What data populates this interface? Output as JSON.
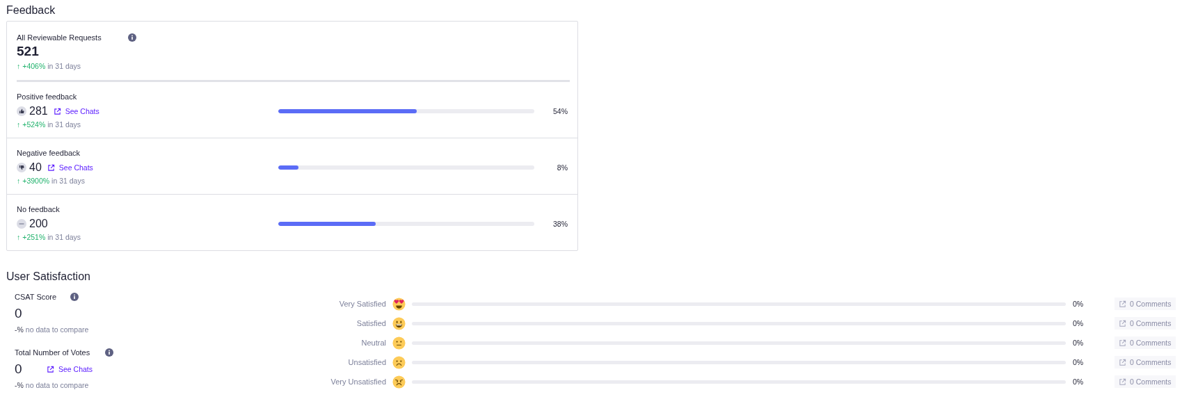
{
  "feedback": {
    "title": "Feedback",
    "total": {
      "label": "All Reviewable Requests",
      "value": "521",
      "trend": {
        "arrow": "↑",
        "change": "+406%",
        "period": "in 31 days"
      }
    },
    "rows": [
      {
        "label": "Positive feedback",
        "kind": "thumbs_up",
        "value": "281",
        "link": "See Chats",
        "level": 0.54,
        "percent": "54%",
        "trend": {
          "arrow": "↑",
          "change": "+524%",
          "period": "in 31 days"
        }
      },
      {
        "label": "Negative feedback",
        "kind": "thumbs_down",
        "value": "40",
        "link": "See Chats",
        "level": 0.08,
        "percent": "8%",
        "trend": {
          "arrow": "↑",
          "change": "+3900%",
          "period": "in 31 days"
        }
      },
      {
        "label": "No feedback",
        "kind": "none",
        "value": "200",
        "level": 0.38,
        "percent": "38%",
        "trend": {
          "arrow": "↑",
          "change": "+251%",
          "period": "in 31 days"
        }
      }
    ]
  },
  "satisfaction": {
    "title": "User Satisfaction",
    "stats": [
      {
        "label": "CSAT Score",
        "value": "0",
        "trend": {
          "change": "-%",
          "period": "no data to compare"
        }
      },
      {
        "label": "Total Number of Votes",
        "value": "0",
        "link": "See Chats",
        "trend": {
          "change": "-%",
          "period": "no data to compare"
        }
      }
    ],
    "ratings": [
      {
        "label": "Very Satisfied",
        "kind": "heart_eyes",
        "level": 0,
        "percent": "0%",
        "comments": "0 Comments",
        "disabled": true
      },
      {
        "label": "Satisfied",
        "kind": "grin",
        "level": 0,
        "percent": "0%",
        "comments": "0 Comments",
        "disabled": true
      },
      {
        "label": "Neutral",
        "kind": "neutral",
        "level": 0,
        "percent": "0%",
        "comments": "0 Comments",
        "disabled": true
      },
      {
        "label": "Unsatisfied",
        "kind": "frown",
        "level": 0,
        "percent": "0%",
        "comments": "0 Comments",
        "disabled": true
      },
      {
        "label": "Very Unsatisfied",
        "kind": "angry",
        "level": 0,
        "percent": "0%",
        "comments": "0 Comments",
        "disabled": true
      }
    ]
  }
}
